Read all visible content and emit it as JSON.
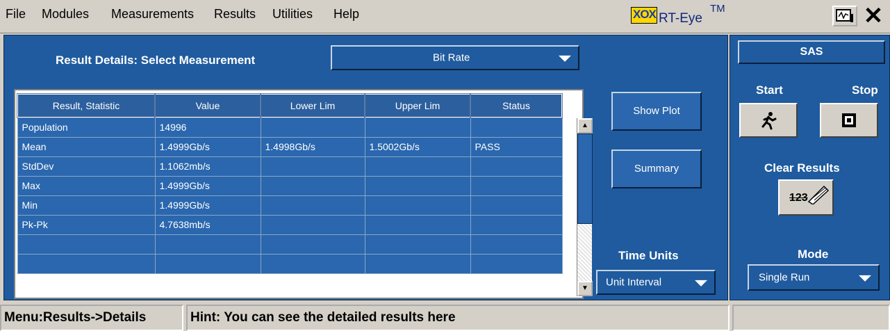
{
  "menu": [
    "File",
    "Modules",
    "Measurements",
    "Results",
    "Utilities",
    "Help"
  ],
  "app": {
    "logo": "XOX",
    "title": "RT-Eye",
    "tm": "TM"
  },
  "details": {
    "label": "Result Details: Select Measurement",
    "measurement": "Bit Rate"
  },
  "table": {
    "headers": [
      "Result, Statistic",
      "Value",
      "Lower Lim",
      "Upper Lim",
      "Status"
    ],
    "rows": [
      [
        "Population",
        "14996",
        "",
        "",
        ""
      ],
      [
        "Mean",
        "1.4999Gb/s",
        "1.4998Gb/s",
        "1.5002Gb/s",
        "PASS"
      ],
      [
        "StdDev",
        "1.1062mb/s",
        "",
        "",
        ""
      ],
      [
        "Max",
        "1.4999Gb/s",
        "",
        "",
        ""
      ],
      [
        "Min",
        "1.4999Gb/s",
        "",
        "",
        ""
      ],
      [
        "Pk-Pk",
        "4.7638mb/s",
        "",
        "",
        ""
      ],
      [
        "",
        "",
        "",
        "",
        ""
      ],
      [
        "",
        "",
        "",
        "",
        ""
      ]
    ]
  },
  "buttons": {
    "show_plot": "Show Plot",
    "summary": "Summary"
  },
  "time_units": {
    "label": "Time Units",
    "value": "Unit Interval"
  },
  "right": {
    "standard": "SAS",
    "start": "Start",
    "stop": "Stop",
    "clear": "Clear Results",
    "clear_icon_text": "123",
    "mode_label": "Mode",
    "mode_value": "Single Run"
  },
  "status": {
    "menu_path": "Menu:Results->Details",
    "hint": "Hint: You can see the detailed results here"
  }
}
